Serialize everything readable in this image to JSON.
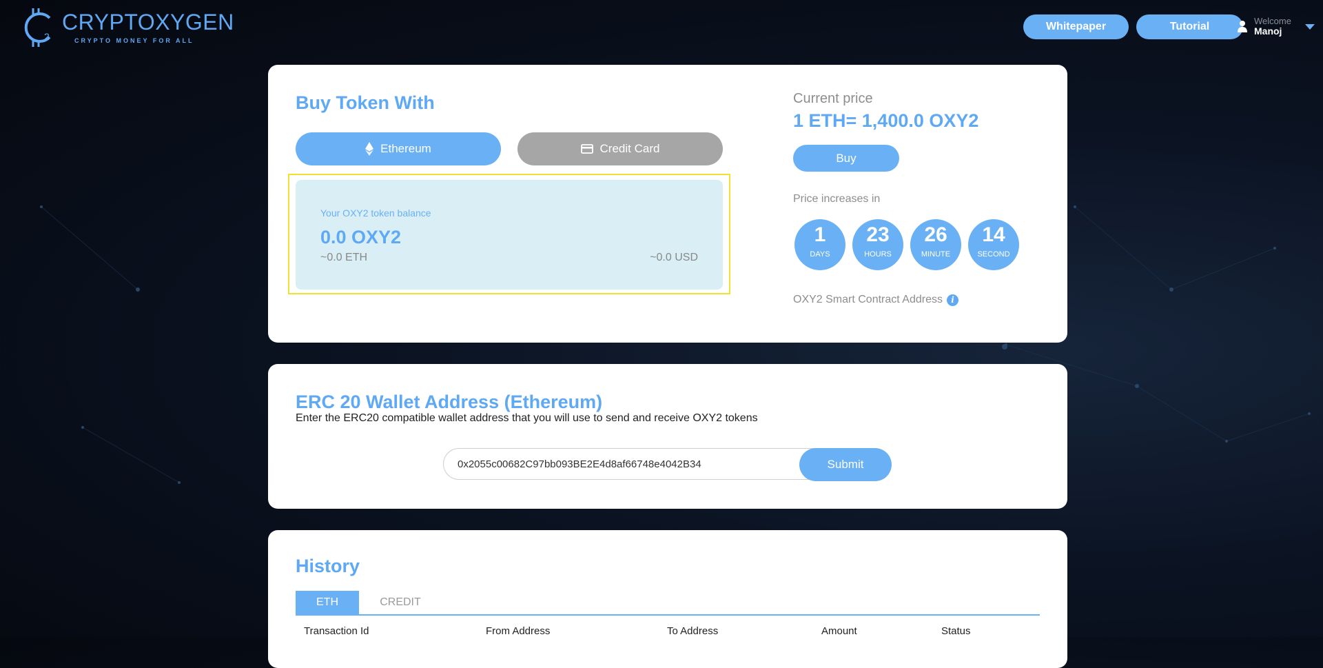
{
  "header": {
    "logo_name": "CRYPTOXYGEN",
    "logo_tagline": "CRYPTO MONEY FOR ALL",
    "whitepaper_label": "Whitepaper",
    "tutorial_label": "Tutorial",
    "welcome_label": "Welcome",
    "user_name": "Manoj"
  },
  "buy": {
    "title": "Buy Token With",
    "ethereum_label": "Ethereum",
    "credit_card_label": "Credit Card",
    "balance_label": "Your OXY2 token balance",
    "balance_value": "0.0 OXY2",
    "balance_eth": "~0.0 ETH",
    "balance_usd": "~0.0 USD"
  },
  "price": {
    "current_label": "Current price",
    "current_value": "1 ETH= 1,400.0 OXY2",
    "buy_label": "Buy",
    "increases_label": "Price increases in",
    "countdown": [
      {
        "value": "1",
        "unit": "DAYS"
      },
      {
        "value": "23",
        "unit": "HOURS"
      },
      {
        "value": "26",
        "unit": "MINUTE"
      },
      {
        "value": "14",
        "unit": "SECOND"
      }
    ],
    "contract_label": "OXY2 Smart Contract Address",
    "info_glyph": "i"
  },
  "wallet": {
    "title": "ERC 20 Wallet Address (Ethereum)",
    "description": "Enter the ERC20 compatible wallet address that you will use to send and receive OXY2 tokens",
    "address_value": "0x2055c00682C97bb093BE2E4d8af66748e4042B34",
    "submit_label": "Submit"
  },
  "history": {
    "title": "History",
    "tabs": [
      "ETH",
      "CREDIT"
    ],
    "columns": [
      "Transaction Id",
      "From Address",
      "To Address",
      "Amount",
      "Status"
    ]
  },
  "colors": {
    "accent": "#6ab0f5",
    "title_blue": "#5fa8f4",
    "balance_bg": "#d9eff5",
    "highlight_border": "#f1e130",
    "credit_gray": "#a6a6a6"
  },
  "icons": [
    "logo-mark-icon",
    "ethereum-icon",
    "credit-card-icon",
    "user-icon",
    "chevron-down-icon",
    "info-icon"
  ]
}
